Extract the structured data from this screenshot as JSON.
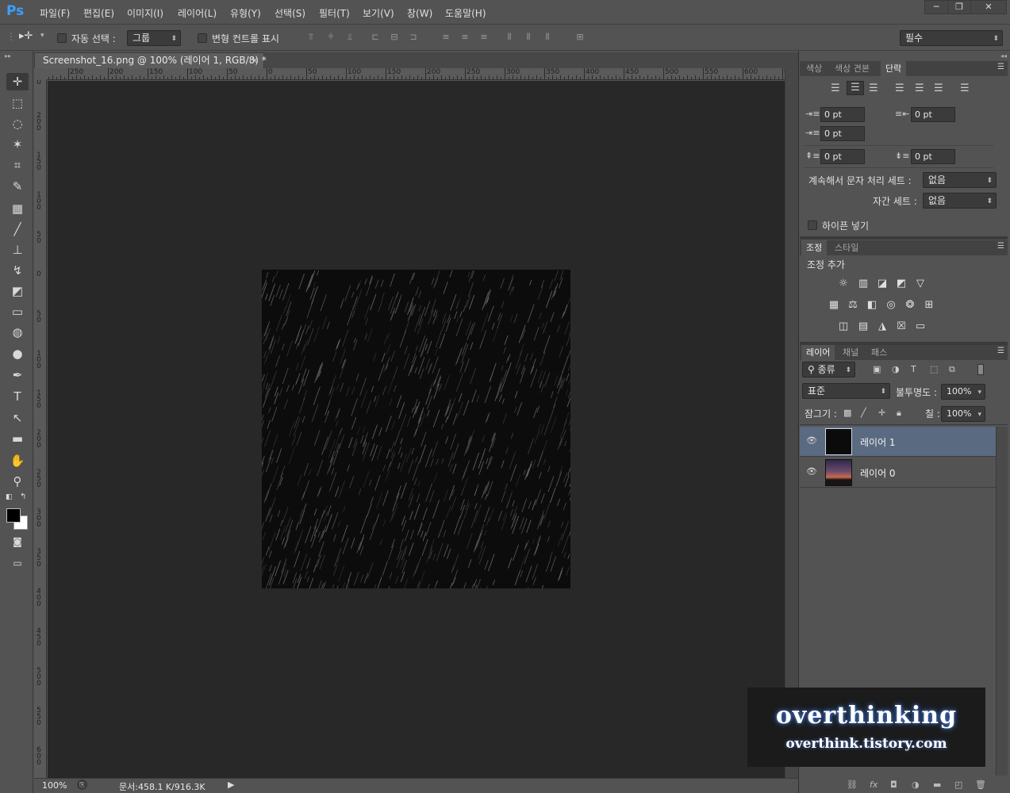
{
  "app": {
    "logo": "Ps",
    "menu": [
      "파일(F)",
      "편집(E)",
      "이미지(I)",
      "레이어(L)",
      "유형(Y)",
      "선택(S)",
      "필터(T)",
      "보기(V)",
      "창(W)",
      "도움말(H)"
    ]
  },
  "window_controls": {
    "minimize": "─",
    "restore": "❐",
    "close": "✕"
  },
  "options": {
    "tool_glyph": "▸✛",
    "auto_select_label": "자동 선택 :",
    "auto_select_value": "그룹",
    "transform_label": "변형 컨트롤 표시",
    "workspace": "필수"
  },
  "document": {
    "tab_title": "Screenshot_16.png @ 100% (레이어 1, RGB/8) *",
    "close": "×",
    "ruler_top_labels": [
      "250",
      "200",
      "150",
      "100",
      "50",
      "0",
      "50",
      "100",
      "150",
      "200",
      "250",
      "300",
      "350",
      "400",
      "450",
      "500",
      "550",
      "600",
      "6"
    ],
    "ruler_left_labels": [
      "5 0",
      "2 0 0",
      "1 5 0",
      "1 0 0",
      "5 0",
      "0",
      "5 0",
      "1 0 0",
      "1 5 0",
      "2 0 0",
      "2 5 0",
      "3 0 0",
      "3 5 0",
      "4 0 0",
      "4 5 0",
      "5 0 0",
      "5 5 0",
      "6 0 0"
    ]
  },
  "status": {
    "zoom": "100%",
    "doc_info": "문서:458.1 K/916.3K",
    "arrow": "▶"
  },
  "panels": {
    "top_tabs": [
      "색상",
      "색상 견본",
      "단락"
    ],
    "paragraph": {
      "indent_left": "0 pt",
      "indent_right": "0 pt",
      "first_line": "0 pt",
      "space_before": "0 pt",
      "space_after": "0 pt",
      "hanging_label": "계속해서 문자 처리 세트 :",
      "hanging_value": "없음",
      "kerning_label": "자간 세트 :",
      "kerning_value": "없음",
      "hyphen_label": "하이픈 넣기"
    },
    "adjust_tabs": [
      "조정",
      "스타일"
    ],
    "adjust_title": "조정 추가",
    "layer_tabs": [
      "레이어",
      "채널",
      "패스"
    ],
    "layers": {
      "filter_kind": "종류",
      "blend_mode": "표준",
      "opacity_label": "불투명도 :",
      "opacity_value": "100%",
      "lock_label": "잠그기 :",
      "fill_label": "칠 :",
      "fill_value": "100%",
      "items": [
        {
          "name": "레이어 1",
          "selected": true
        },
        {
          "name": "레이어 0",
          "selected": false
        }
      ]
    }
  },
  "watermark": {
    "title": "overthinking",
    "subtitle": "overthink.tistory.com"
  },
  "colors": {
    "ui_bg": "#535353",
    "canvas_bg": "#282828",
    "image_bg": "#0c0c0c",
    "selection": "#5a6a80",
    "logo": "#3aa0ff"
  }
}
